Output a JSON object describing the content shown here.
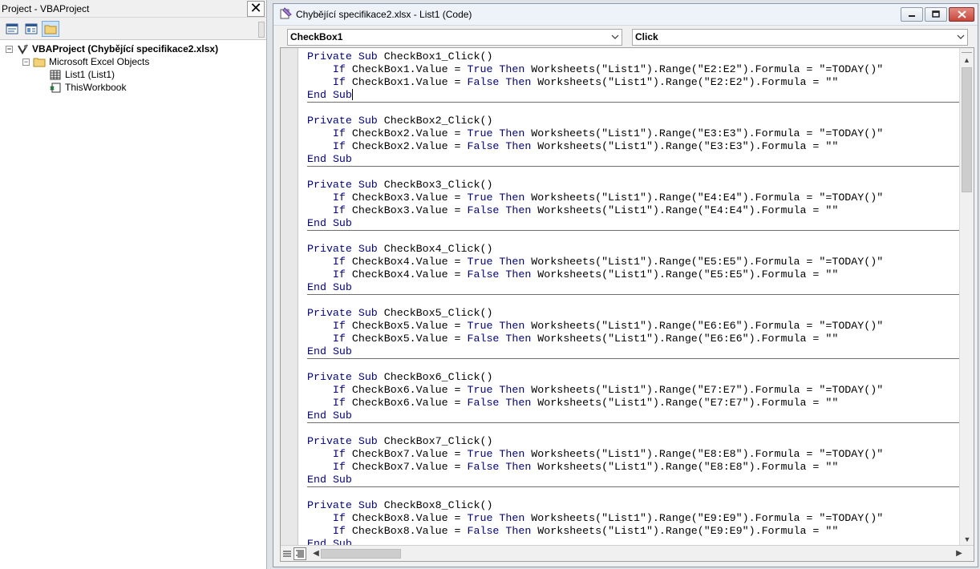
{
  "project": {
    "title": "Project - VBAProject",
    "close_glyph": "✕",
    "toolbar": [
      "view-code-icon",
      "view-object-icon",
      "toggle-folders-icon"
    ],
    "tree": {
      "root": "VBAProject (Chybějící specifikace2.xlsx)",
      "folder": "Microsoft Excel Objects",
      "items": [
        "List1 (List1)",
        "ThisWorkbook"
      ]
    }
  },
  "code_window": {
    "title": "Chybějící specifikace2.xlsx - List1 (Code)",
    "object_combo": "CheckBox1",
    "procedure_combo": "Click",
    "procedures": [
      {
        "name": "CheckBox1",
        "row": "E2:E2"
      },
      {
        "name": "CheckBox2",
        "row": "E3:E3"
      },
      {
        "name": "CheckBox3",
        "row": "E4:E4"
      },
      {
        "name": "CheckBox4",
        "row": "E5:E5"
      },
      {
        "name": "CheckBox5",
        "row": "E6:E6"
      },
      {
        "name": "CheckBox6",
        "row": "E7:E7"
      },
      {
        "name": "CheckBox7",
        "row": "E8:E8"
      },
      {
        "name": "CheckBox8",
        "row": "E9:E9"
      }
    ],
    "keywords": {
      "private": "Private",
      "sub": "Sub",
      "if": "If",
      "true": "True",
      "false": "False",
      "then": "Then",
      "end": "End"
    },
    "sheet_name": "List1",
    "true_formula": "=TODAY()",
    "false_formula": ""
  },
  "colors": {
    "keyword": "#00008b",
    "text": "#000000",
    "background": "#ffffff"
  }
}
